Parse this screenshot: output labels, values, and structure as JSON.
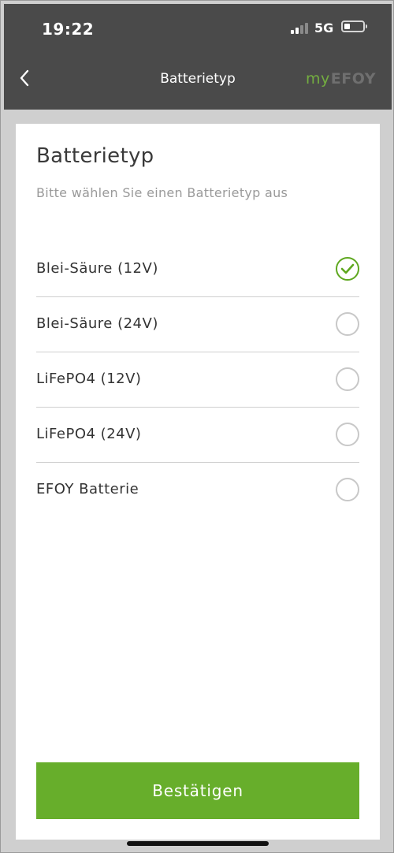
{
  "status_bar": {
    "time": "19:22",
    "network": "5G"
  },
  "header": {
    "title": "Batterietyp",
    "logo_my": "my",
    "logo_efoy": "EFOY"
  },
  "card": {
    "title": "Batterietyp",
    "subtitle": "Bitte wählen Sie einen Batterietyp aus"
  },
  "options": [
    {
      "label": "Blei-Säure (12V)",
      "selected": true
    },
    {
      "label": "Blei-Säure (24V)",
      "selected": false
    },
    {
      "label": "LiFePO4 (12V)",
      "selected": false
    },
    {
      "label": "LiFePO4 (24V)",
      "selected": false
    },
    {
      "label": "EFOY Batterie",
      "selected": false
    }
  ],
  "actions": {
    "confirm_label": "Bestätigen"
  },
  "colors": {
    "accent": "#67ae2b",
    "header_bg": "#4a4a4a",
    "page_bg": "#cfcfcf"
  }
}
